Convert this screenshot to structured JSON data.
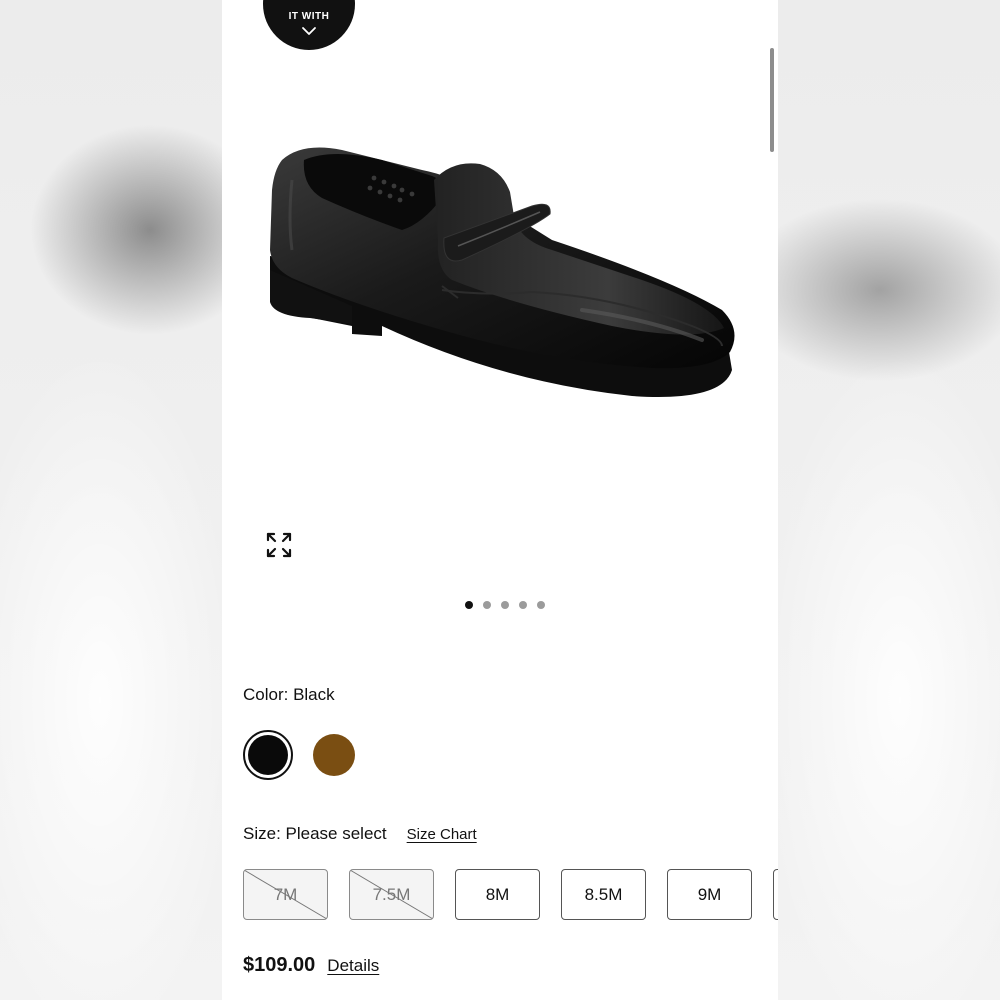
{
  "badge": {
    "label": "IT WITH",
    "icon": "chevron-down-icon"
  },
  "gallery": {
    "image_subject": "black leather penny loafer",
    "expand_icon": "expand-icon",
    "slide_count": 5,
    "active_slide": 1
  },
  "color": {
    "label": "Color: Black",
    "swatches": [
      {
        "name": "Black",
        "hex": "#0a0a0a",
        "selected": true
      },
      {
        "name": "Brown",
        "hex": "#7a4e12",
        "selected": false
      }
    ]
  },
  "size": {
    "label": "Size: Please select",
    "chart_link": "Size Chart",
    "options": [
      {
        "label": "7M",
        "available": false
      },
      {
        "label": "7.5M",
        "available": false
      },
      {
        "label": "8M",
        "available": true
      },
      {
        "label": "8.5M",
        "available": true
      },
      {
        "label": "9M",
        "available": true
      },
      {
        "label": "",
        "available": true
      }
    ]
  },
  "price": {
    "amount": "$109.00",
    "details_link": "Details"
  },
  "colors": {
    "accent": "#111111",
    "unavailable_bg": "#f4f4f4"
  }
}
